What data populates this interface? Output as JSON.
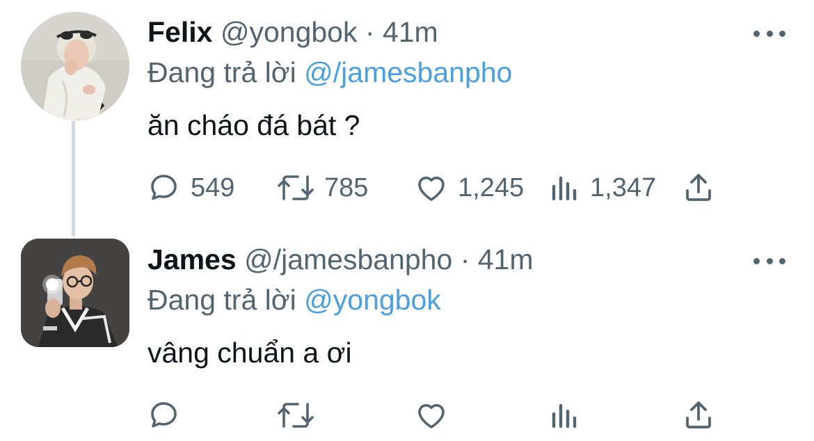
{
  "tweets": [
    {
      "display_name": "Felix",
      "handle": "@yongbok",
      "separator": "·",
      "time": "41m",
      "reply_prefix": "Đang trả lời",
      "reply_to": "@/jamesbanpho",
      "text": "ăn cháo đá bát ?",
      "stats": {
        "replies": "549",
        "retweets": "785",
        "likes": "1,245",
        "views": "1,347"
      },
      "avatar_icon": "avatar-felix"
    },
    {
      "display_name": "James",
      "handle": "@/jamesbanpho",
      "separator": "·",
      "time": "41m",
      "reply_prefix": "Đang trả lời",
      "reply_to": "@yongbok",
      "text": "vâng chuẩn a ơi",
      "stats": {
        "replies": "",
        "retweets": "",
        "likes": "",
        "views": ""
      },
      "avatar_icon": "avatar-james"
    }
  ],
  "icons": {
    "more": "more-horizontal-icon",
    "reply": "speech-bubble-icon",
    "retweet": "retweet-arrows-icon",
    "like": "heart-icon",
    "views": "bar-chart-icon",
    "share": "share-upload-icon"
  },
  "colors": {
    "text_primary": "#0f1419",
    "text_secondary": "#536471",
    "link": "#4a9fe0",
    "thread_line": "#cfd9de",
    "background": "#ffffff"
  }
}
